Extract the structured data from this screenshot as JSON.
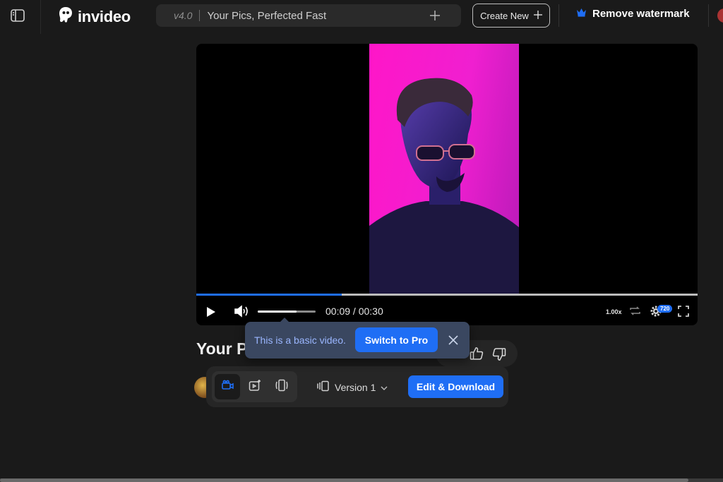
{
  "header": {
    "brand": "invideo",
    "version": "v4.0",
    "project_title": "Your Pics, Perfected Fast",
    "create_new_label": "Create New",
    "remove_watermark_label": "Remove watermark"
  },
  "player": {
    "progress": 0.29,
    "volume": 0.67,
    "time_current": "00:09",
    "time_separator": " / ",
    "time_total": "00:30",
    "speed": "1.00x",
    "quality": "720"
  },
  "content": {
    "heading": "Your P"
  },
  "toolbar": {
    "version_label": "Version 1",
    "edit_download_label": "Edit & Download"
  },
  "tooltip": {
    "text": "This is a basic video.",
    "switch_label": "Switch to Pro"
  },
  "colors": {
    "accent": "#1f6ef5",
    "background": "#1a1a1a",
    "frame_magenta": "#ff16c8"
  },
  "icons": {
    "sidebar": "sidebar-toggle-icon",
    "logo": "invideo-logo-icon",
    "plus": "plus-icon",
    "crown": "crown-icon",
    "play": "play-icon",
    "volume": "volume-icon",
    "loop": "loop-icon",
    "settings": "gear-icon",
    "fullscreen": "fullscreen-icon",
    "thumbs_up": "thumbs-up-icon",
    "thumbs_down": "thumbs-down-icon",
    "close": "close-icon"
  }
}
